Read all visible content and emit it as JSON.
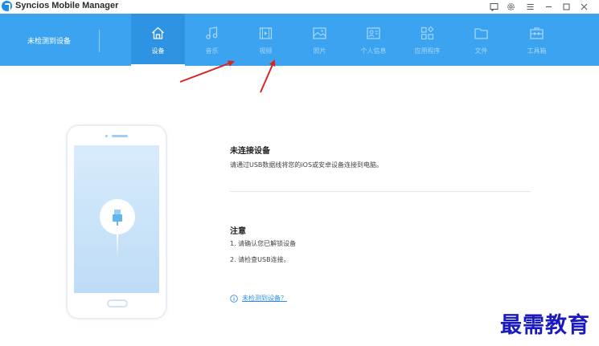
{
  "app": {
    "title": "Syncios Mobile Manager",
    "brand_color": "#3ba3f0"
  },
  "window_controls": [
    {
      "name": "feedback-icon"
    },
    {
      "name": "settings-icon"
    },
    {
      "name": "menu-icon"
    },
    {
      "name": "minimize-icon"
    },
    {
      "name": "maximize-icon"
    },
    {
      "name": "close-icon"
    }
  ],
  "device_status": "未检测到设备",
  "nav": {
    "tabs": [
      {
        "label": "设备",
        "icon": "home-icon",
        "active": true
      },
      {
        "label": "音乐",
        "icon": "music-icon",
        "active": false
      },
      {
        "label": "视频",
        "icon": "video-icon",
        "active": false
      },
      {
        "label": "照片",
        "icon": "photo-icon",
        "active": false
      },
      {
        "label": "个人信息",
        "icon": "contact-card-icon",
        "active": false
      },
      {
        "label": "应用程序",
        "icon": "apps-icon",
        "active": false
      },
      {
        "label": "文件",
        "icon": "folder-icon",
        "active": false
      },
      {
        "label": "工具箱",
        "icon": "toolbox-icon",
        "active": false
      }
    ]
  },
  "main": {
    "connect_heading": "未连接设备",
    "connect_desc": "请通过USB数据线将您的iOS或安卓设备连接到电脑。",
    "notes_heading": "注意",
    "notes": [
      "1. 请确认您已解锁设备",
      "2. 请检查USB连接。"
    ],
    "help_link": "未检测到设备？"
  },
  "watermark": "最需教育"
}
